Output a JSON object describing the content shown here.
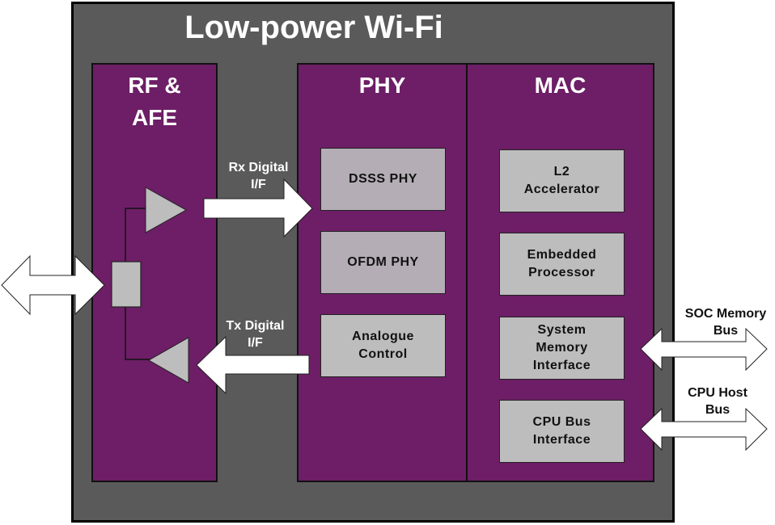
{
  "title": "Low-power Wi-Fi",
  "panels": {
    "rf_afe": {
      "title": "RF &\nAFE"
    },
    "phy": {
      "title": "PHY",
      "blocks": [
        "DSSS PHY",
        "OFDM PHY",
        "Analogue\nControl"
      ]
    },
    "mac": {
      "title": "MAC",
      "blocks": [
        "L2\nAccelerator",
        "Embedded\nProcessor",
        "System\nMemory\nInterface",
        "CPU Bus\nInterface"
      ]
    }
  },
  "interfaces": {
    "rx": "Rx Digital\nI/F",
    "tx": "Tx Digital\nI/F",
    "soc_bus": "SOC Memory\nBus",
    "cpu_bus": "CPU Host\nBus"
  },
  "colors": {
    "panel": "#6d1e66",
    "background": "#5a5a5a",
    "block": "#bdbdbd",
    "phy_block": "#b4adb5"
  }
}
